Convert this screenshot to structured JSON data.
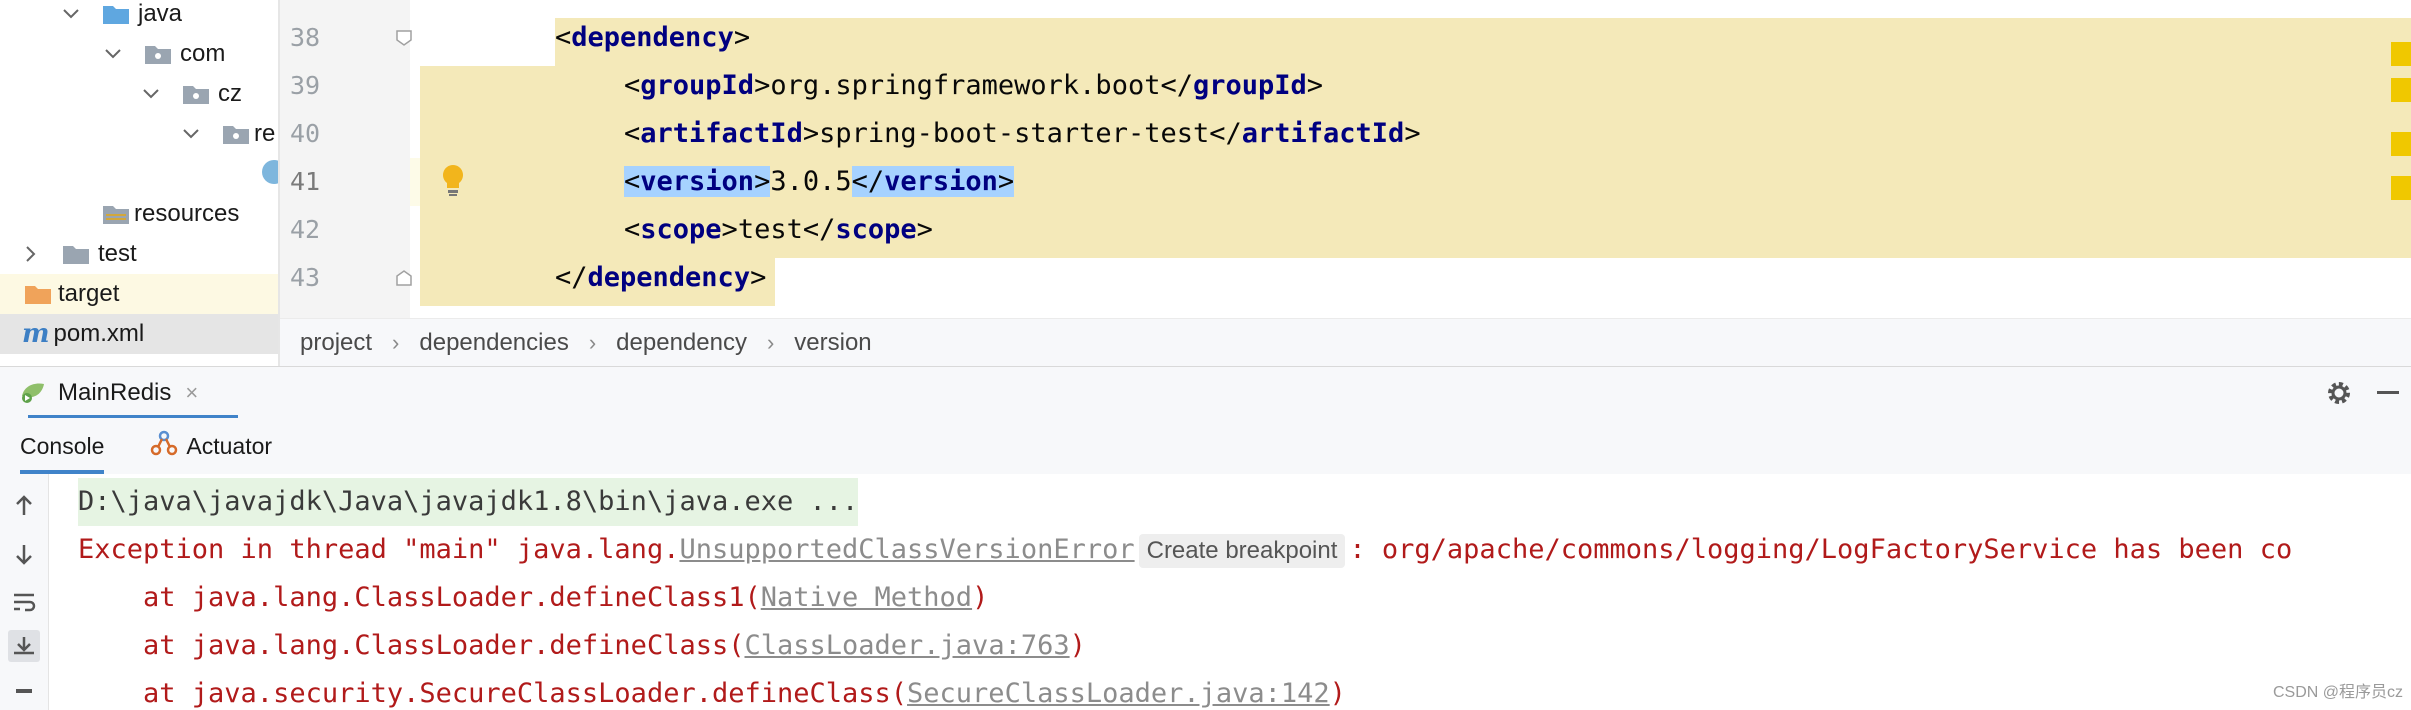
{
  "tree": {
    "items": [
      {
        "label": "java",
        "kind": "folder-blue",
        "expanded": true
      },
      {
        "label": "com",
        "kind": "package",
        "expanded": true
      },
      {
        "label": "cz",
        "kind": "package",
        "expanded": true
      },
      {
        "label": "re",
        "kind": "package",
        "expanded": true
      },
      {
        "label": "resources",
        "kind": "folder-res"
      },
      {
        "label": "test",
        "kind": "folder-grey",
        "expanded": false
      },
      {
        "label": "target",
        "kind": "folder-orange"
      },
      {
        "label": "pom.xml",
        "kind": "maven-file"
      }
    ]
  },
  "editor": {
    "line_numbers": [
      "38",
      "39",
      "40",
      "41",
      "42",
      "43"
    ],
    "current_line": "41",
    "lines": [
      {
        "open": "<",
        "tag": "dependency",
        "close": ">",
        "text": "",
        "open2": "",
        "tag2": "",
        "close2": ""
      },
      {
        "open": "<",
        "tag": "groupId",
        "close": ">",
        "text": "org.springframework.boot",
        "open2": "</",
        "tag2": "groupId",
        "close2": ">"
      },
      {
        "open": "<",
        "tag": "artifactId",
        "close": ">",
        "text": "spring-boot-starter-test",
        "open2": "</",
        "tag2": "artifactId",
        "close2": ">"
      },
      {
        "open": "<",
        "tag": "version",
        "close": ">",
        "text": "3.0.5",
        "open2": "</",
        "tag2": "version",
        "close2": ">"
      },
      {
        "open": "<",
        "tag": "scope",
        "close": ">",
        "text": "test",
        "open2": "</",
        "tag2": "scope",
        "close2": ">"
      },
      {
        "open": "</",
        "tag": "dependency",
        "close": ">",
        "text": "",
        "open2": "",
        "tag2": "",
        "close2": ""
      }
    ]
  },
  "breadcrumb": [
    "project",
    "dependencies",
    "dependency",
    "version"
  ],
  "breadcrumb_separator": "›",
  "run": {
    "tab_title": "MainRedis",
    "close_glyph": "×",
    "tabs": [
      "Console",
      "Actuator"
    ]
  },
  "console": {
    "cmd": "D:\\java\\javajdk\\Java\\javajdk1.8\\bin\\java.exe ...",
    "exception_prefix": "Exception in thread \"main\" java.lang.",
    "exception_class": "UnsupportedClassVersionError",
    "inlay_hint": "Create breakpoint",
    "exception_suffix": ": org/apache/commons/logging/LogFactoryService has been co",
    "frames": [
      {
        "prefix": "    at java.lang.ClassLoader.defineClass1(",
        "link": "Native Method",
        "suffix": ")"
      },
      {
        "prefix": "    at java.lang.ClassLoader.defineClass(",
        "link": "ClassLoader.java:763",
        "suffix": ")"
      },
      {
        "prefix": "    at java.security.SecureClassLoader.defineClass(",
        "link": "SecureClassLoader.java:142",
        "suffix": ")"
      }
    ]
  },
  "watermark": "CSDN @程序员cz",
  "colors": {
    "accent": "#4083c9",
    "xml_tag": "#000080",
    "error_text": "#b11a1a",
    "highlight_block": "#f4e9b9",
    "selection": "#a6d2ff",
    "marker": "#f0c800"
  }
}
